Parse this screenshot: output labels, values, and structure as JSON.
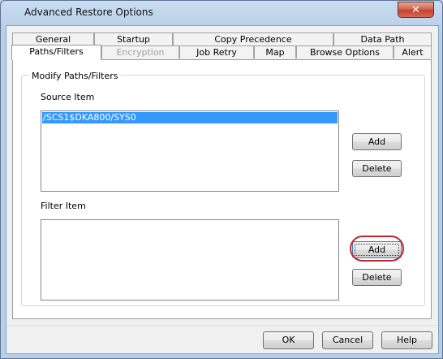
{
  "window": {
    "title": "Advanced Restore Options",
    "close_glyph": "✕"
  },
  "tabs": {
    "row1": [
      "General",
      "Startup",
      "Copy Precedence",
      "Data Path"
    ],
    "row2": [
      "Paths/Filters",
      "Encryption",
      "Job Retry",
      "Map",
      "Browse Options",
      "Alert"
    ]
  },
  "group": {
    "label": "Modify Paths/Filters"
  },
  "source": {
    "label": "Source Item",
    "items": [
      "/SCS1$DKA800/SYS0"
    ],
    "add_label": "Add",
    "delete_label": "Delete"
  },
  "filter": {
    "label": "Filter Item",
    "add_label": "Add",
    "delete_label": "Delete"
  },
  "footer": {
    "ok_label": "OK",
    "cancel_label": "Cancel",
    "help_label": "Help"
  },
  "colors": {
    "selection": "#3399ff",
    "highlight_ring": "#c0262d"
  }
}
